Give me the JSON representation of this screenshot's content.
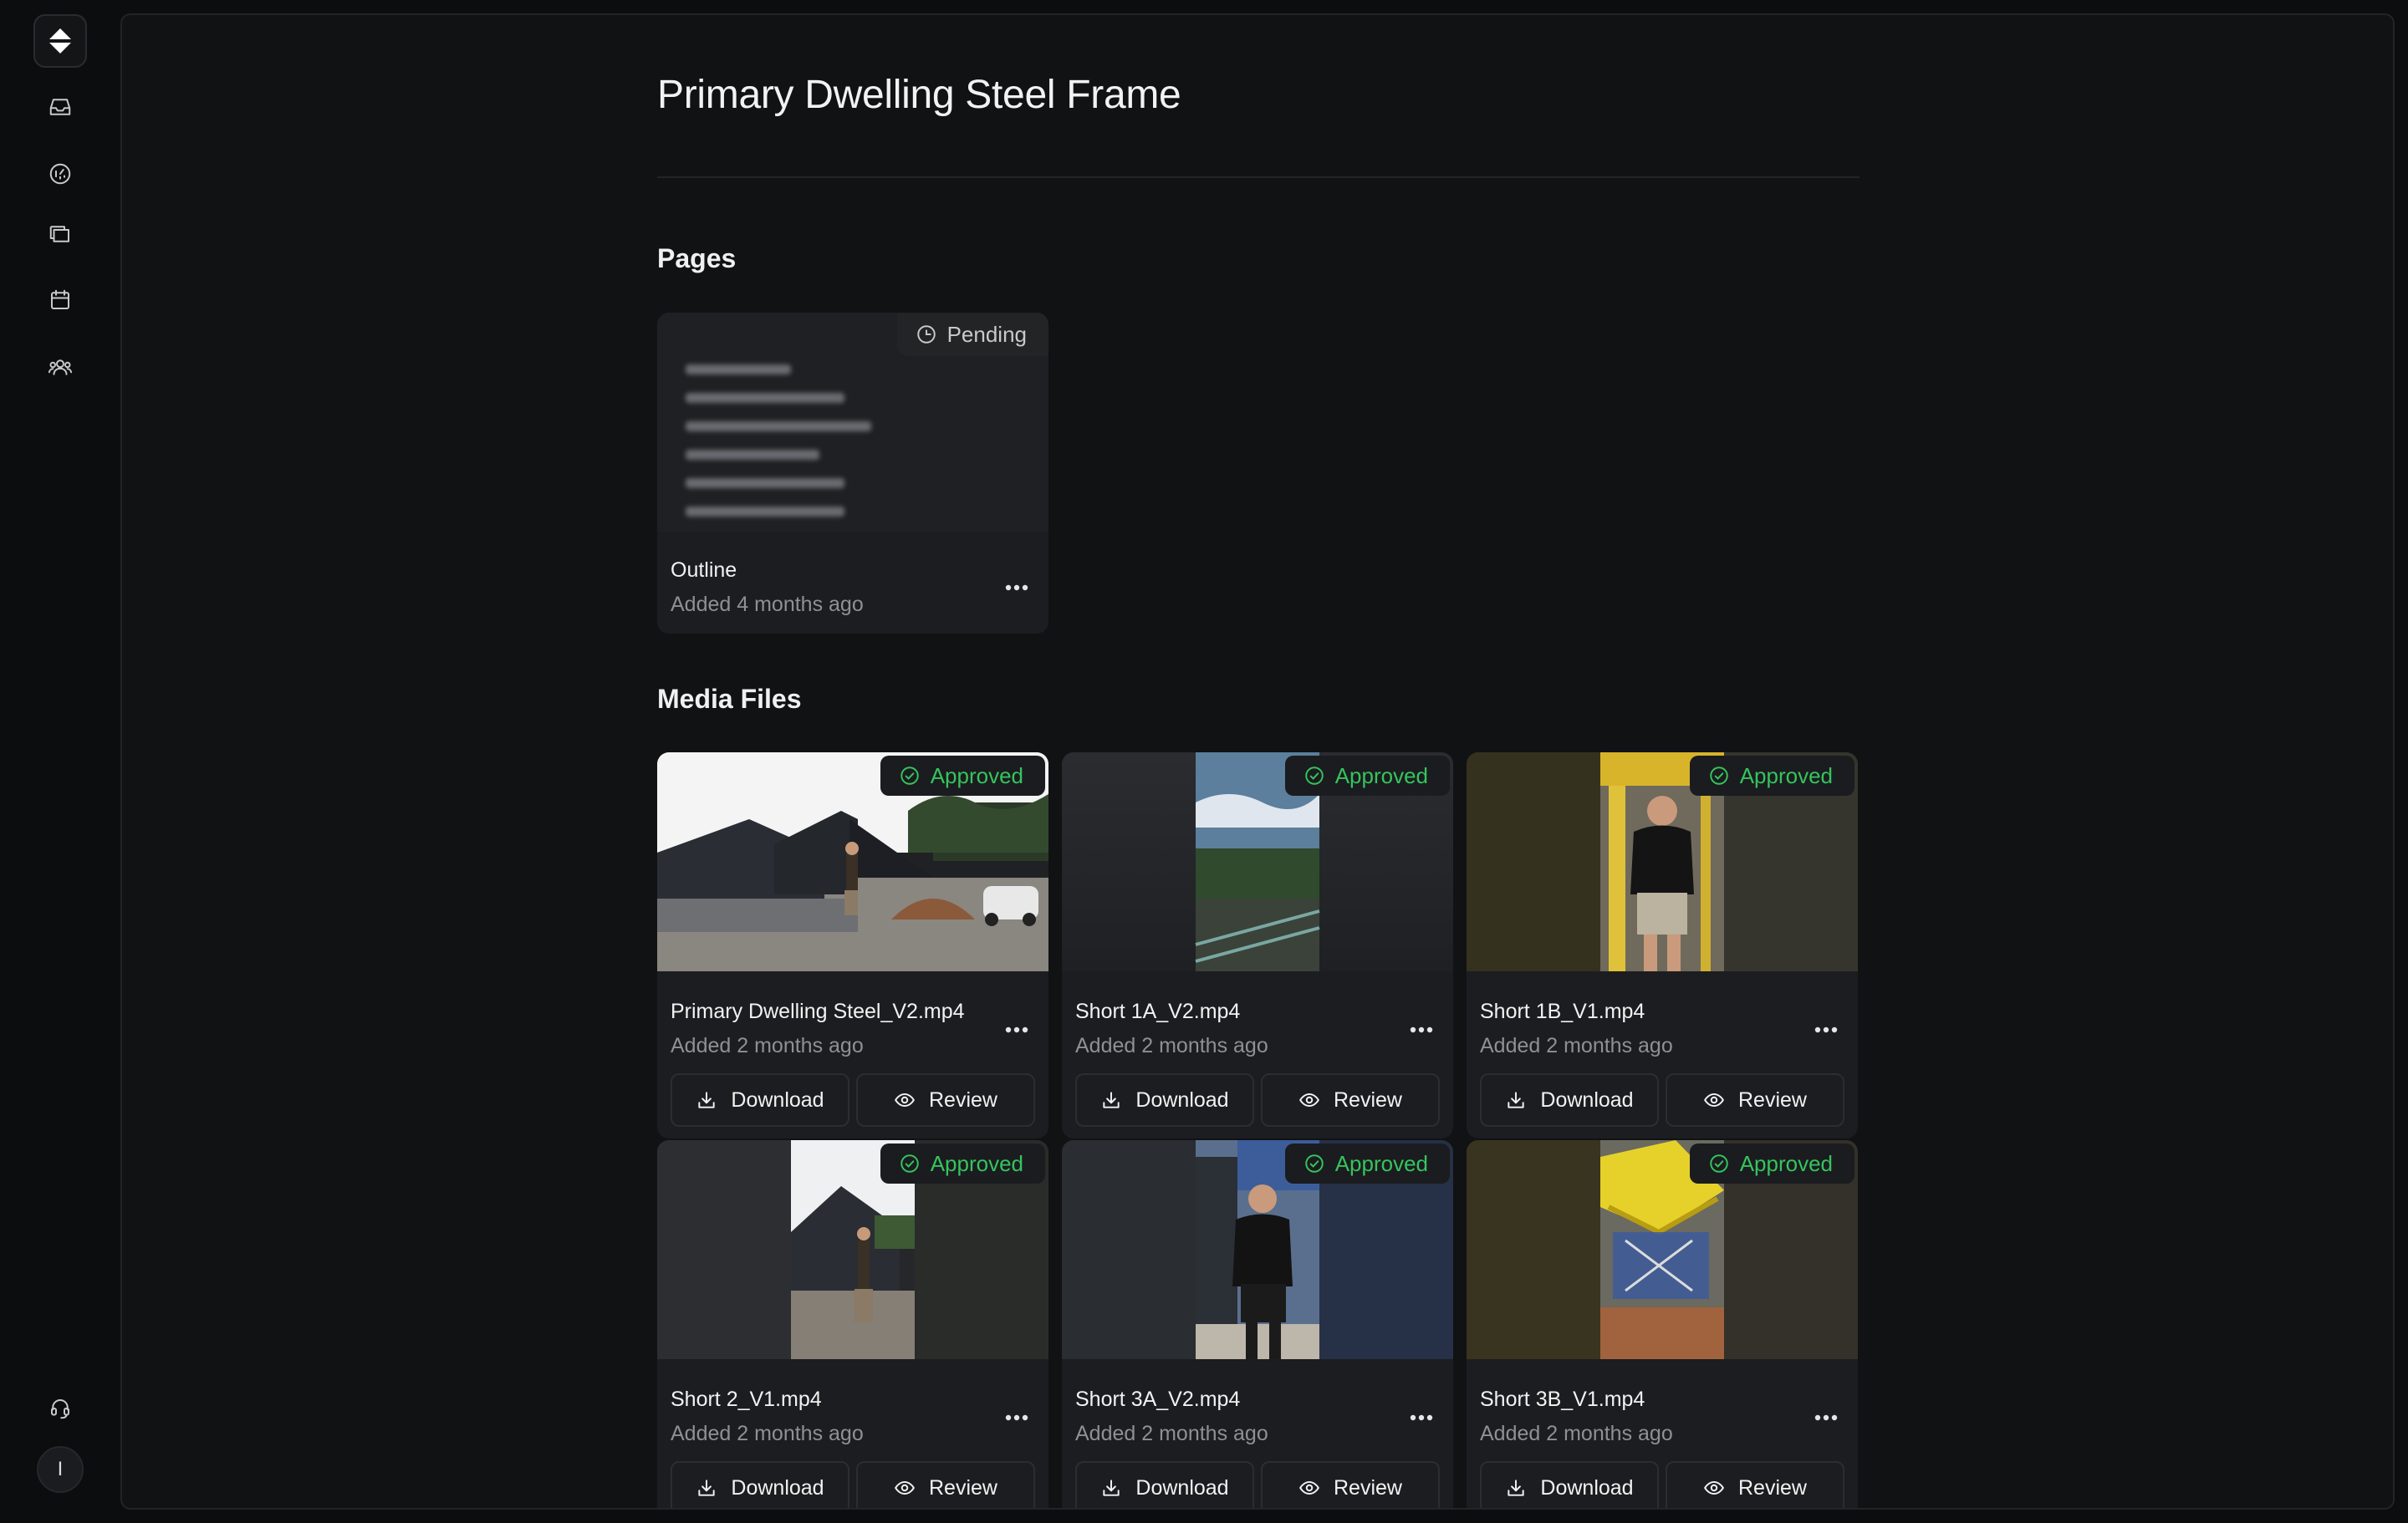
{
  "sidebar": {
    "nav": [
      {
        "icon": "inbox-icon"
      },
      {
        "icon": "dashboard-gauge-icon"
      },
      {
        "icon": "folders-icon"
      },
      {
        "icon": "calendar-icon"
      },
      {
        "icon": "team-icon"
      }
    ],
    "support_icon": "headset-icon",
    "avatar_initial": "I"
  },
  "page": {
    "title": "Primary Dwelling Steel Frame"
  },
  "pages_section": {
    "title": "Pages",
    "items": [
      {
        "name": "Outline",
        "meta": "Added 4 months ago",
        "status": "Pending"
      }
    ]
  },
  "media_section": {
    "title": "Media Files",
    "download_label": "Download",
    "review_label": "Review",
    "items": [
      {
        "name": "Primary Dwelling Steel_V2.mp4",
        "meta": "Added 2 months ago",
        "status": "Approved"
      },
      {
        "name": "Short 1A_V2.mp4",
        "meta": "Added 2 months ago",
        "status": "Approved"
      },
      {
        "name": "Short 1B_V1.mp4",
        "meta": "Added 2 months ago",
        "status": "Approved"
      },
      {
        "name": "Short 2_V1.mp4",
        "meta": "Added 2 months ago",
        "status": "Approved"
      },
      {
        "name": "Short 3A_V2.mp4",
        "meta": "Added 2 months ago",
        "status": "Approved"
      },
      {
        "name": "Short 3B_V1.mp4",
        "meta": "Added 2 months ago",
        "status": "Approved"
      }
    ]
  },
  "colors": {
    "background": "#0c0d0e",
    "panel": "#111214",
    "card": "#1c1d20",
    "approved": "#35c45e",
    "muted_text": "#8f9094"
  }
}
